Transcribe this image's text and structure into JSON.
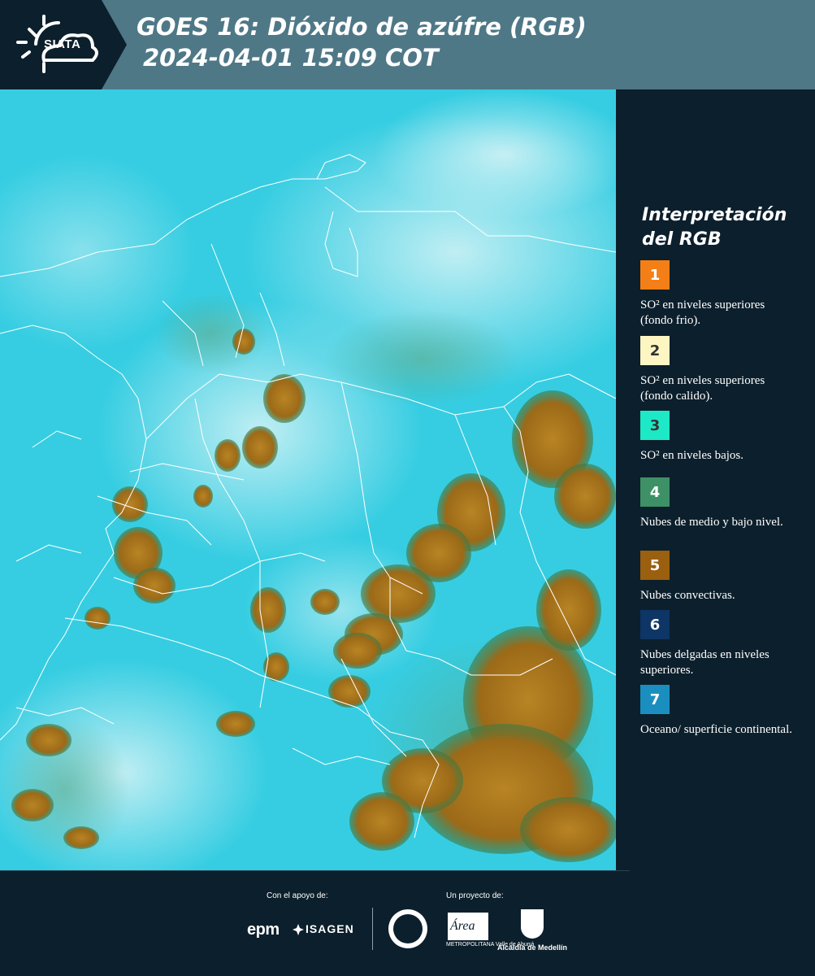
{
  "header": {
    "logo_text": "SIATA",
    "title_line1": "GOES 16: Dióxido de azúfre (RGB)",
    "title_line2": "2024-04-01 15:09 COT"
  },
  "legend": {
    "title_line1": "Interpretación",
    "title_line2": "del RGB",
    "items": [
      {
        "number": "1",
        "color": "#f57f17",
        "text_color": "#ffffff",
        "label": "SO² en niveles superiores (fondo frio)."
      },
      {
        "number": "2",
        "color": "#fdf6c3",
        "text_color": "#333333",
        "label": "SO² en niveles superiores (fondo calido)."
      },
      {
        "number": "3",
        "color": "#1de9c6",
        "text_color": "#333333",
        "label": "SO² en niveles bajos."
      },
      {
        "number": "4",
        "color": "#3e9166",
        "text_color": "#ffffff",
        "label": "Nubes de medio y bajo nivel."
      },
      {
        "number": "5",
        "color": "#9a5f0f",
        "text_color": "#ffffff",
        "label": "Nubes convectivas."
      },
      {
        "number": "6",
        "color": "#0d3566",
        "text_color": "#ffffff",
        "label": "Nubes delgadas en niveles superiores."
      },
      {
        "number": "7",
        "color": "#1a8fbf",
        "text_color": "#ffffff",
        "label": "Oceano/ superficie continental."
      }
    ]
  },
  "footer": {
    "support_label": "Con el apoyo de:",
    "project_label": "Un proyecto de:",
    "epm": "epm",
    "isagen": "ISAGEN",
    "area_logo": "Área",
    "area_sub": "METROPOLITANA Valle de Aburrá",
    "medellin": "Alcaldía de Medellín"
  }
}
